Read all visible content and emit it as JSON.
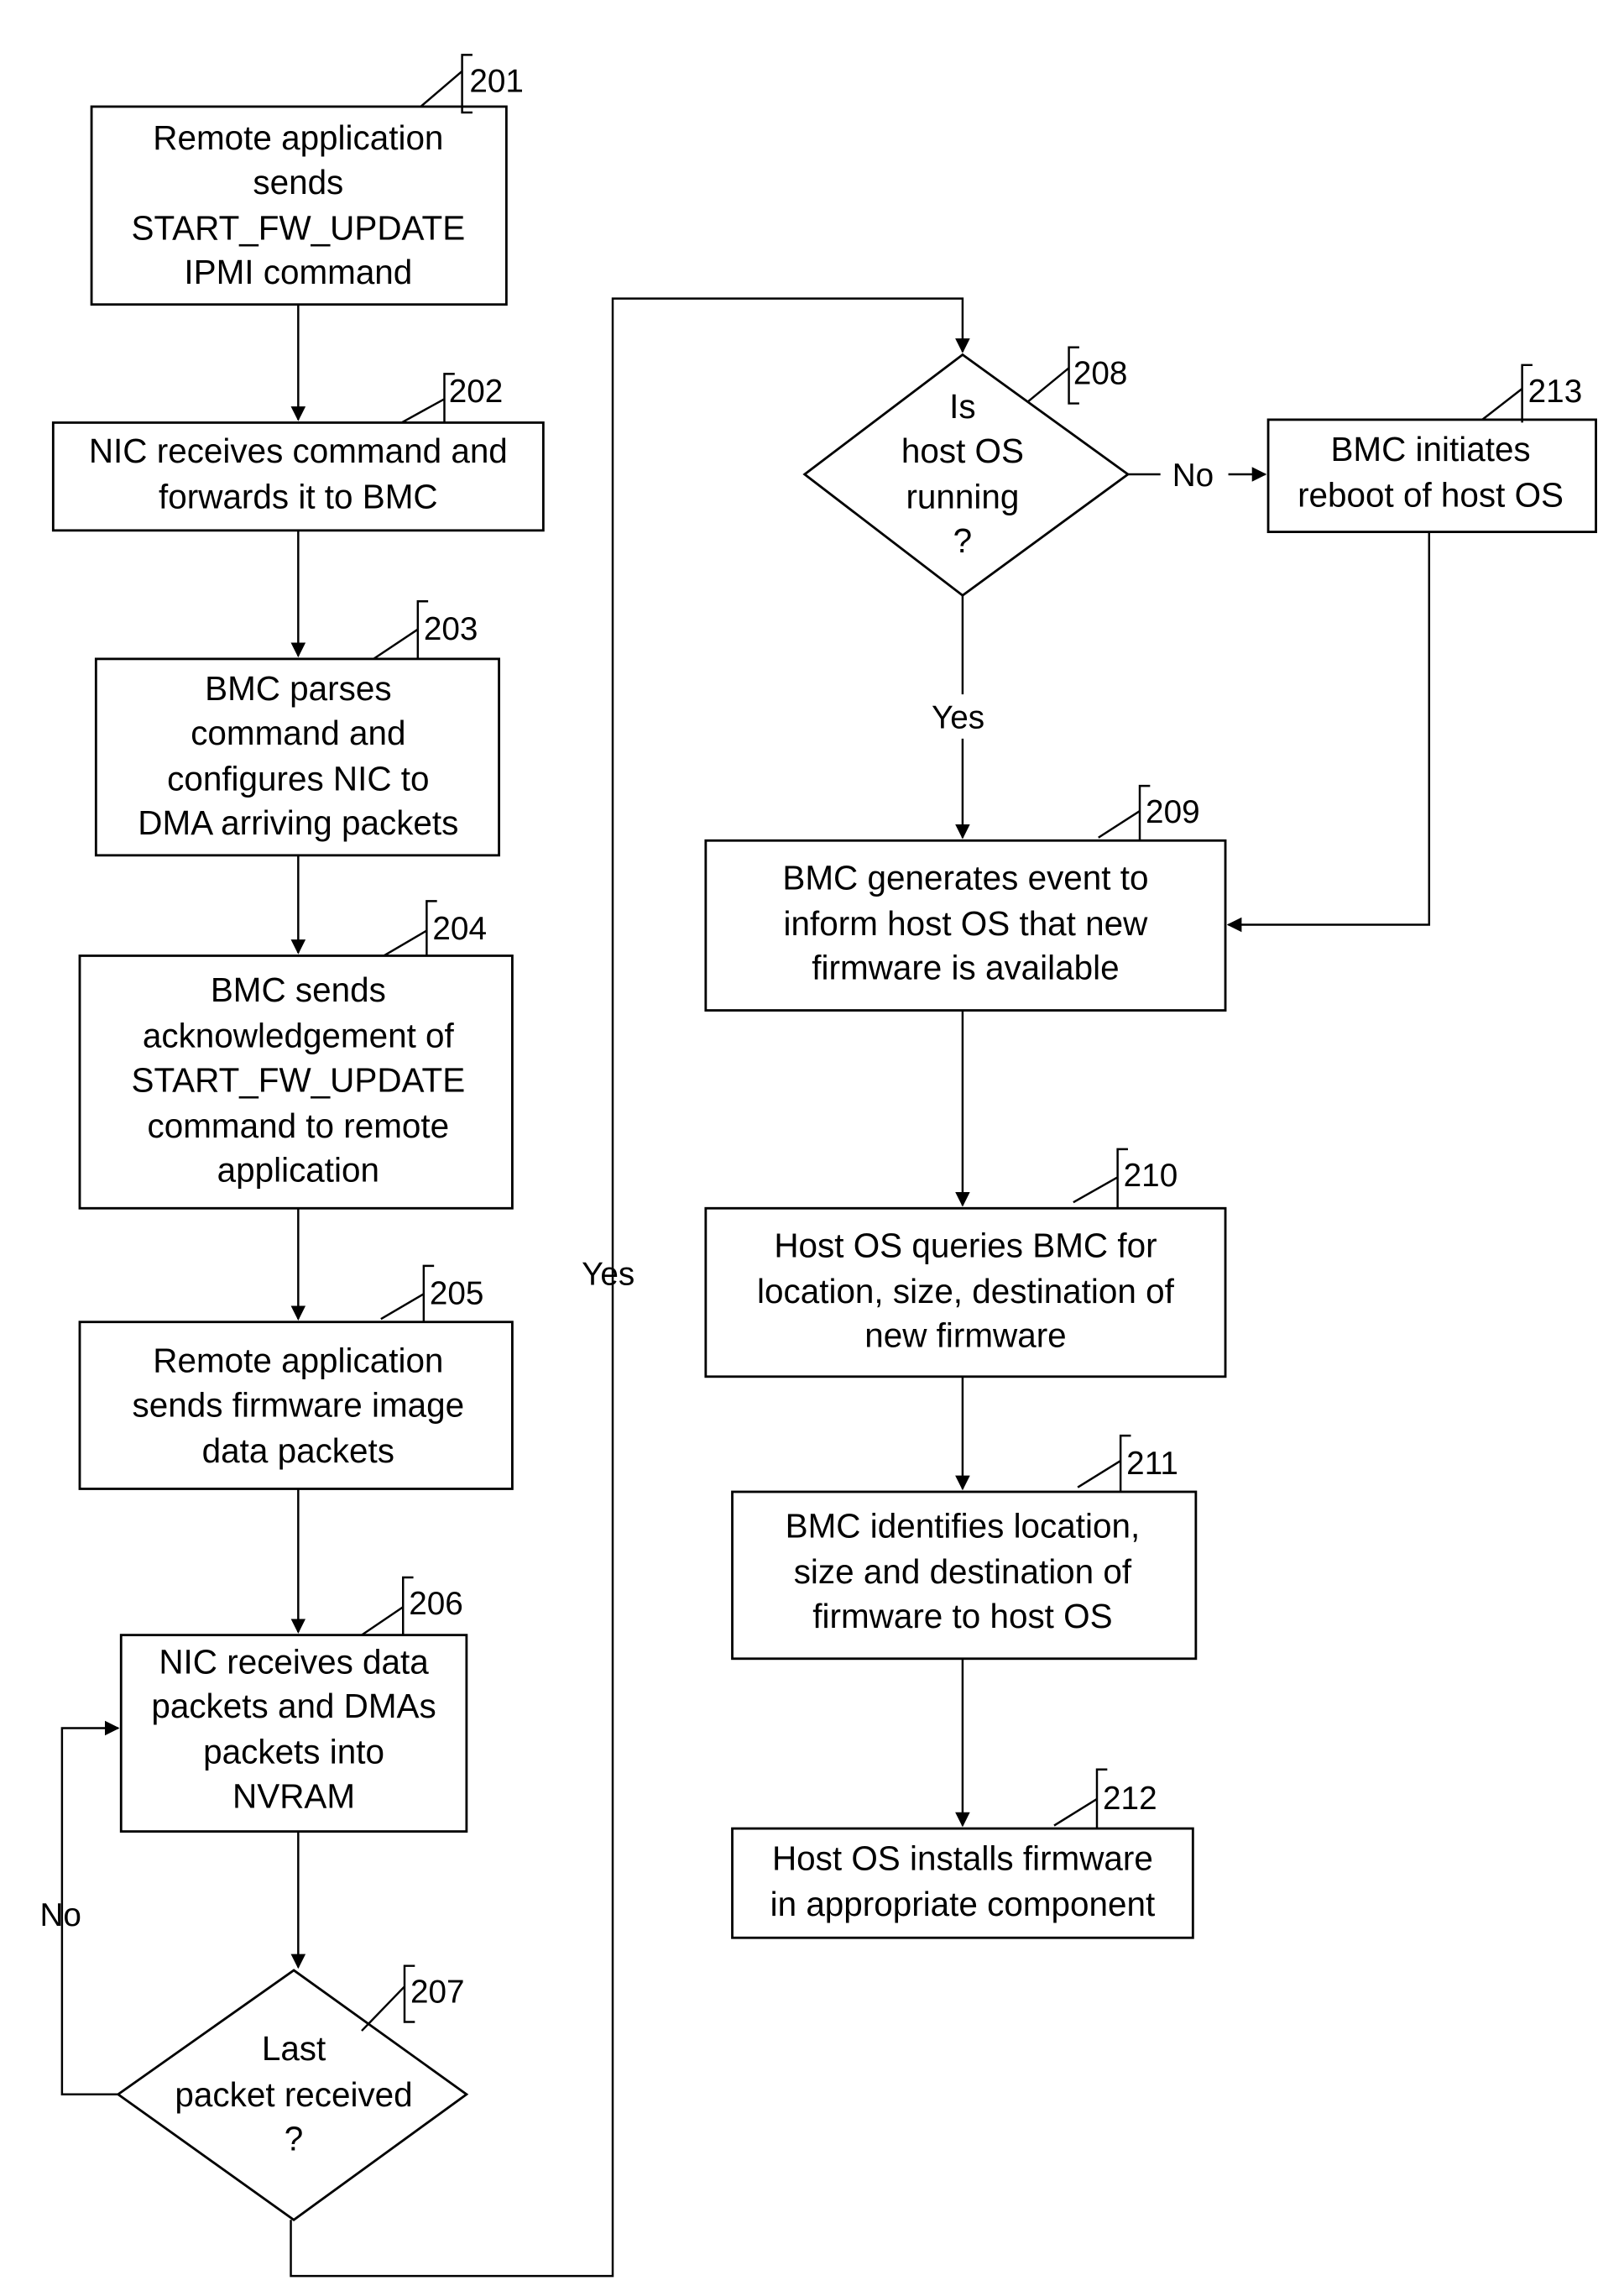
{
  "diagram": {
    "type": "flowchart",
    "nodes": [
      {
        "id": "201",
        "shape": "process",
        "lines": [
          "Remote application",
          "sends",
          "START_FW_UPDATE",
          "IPMI command"
        ]
      },
      {
        "id": "202",
        "shape": "process",
        "lines": [
          "NIC receives command and",
          "forwards it to BMC"
        ]
      },
      {
        "id": "203",
        "shape": "process",
        "lines": [
          "BMC parses",
          "command and",
          "configures NIC to",
          "DMA arriving packets"
        ]
      },
      {
        "id": "204",
        "shape": "process",
        "lines": [
          "BMC sends",
          "acknowledgement of",
          "START_FW_UPDATE",
          "command to remote",
          "application"
        ]
      },
      {
        "id": "205",
        "shape": "process",
        "lines": [
          "Remote application",
          "sends firmware image",
          "data packets"
        ]
      },
      {
        "id": "206",
        "shape": "process",
        "lines": [
          "NIC receives data",
          "packets and DMAs",
          "packets into",
          "NVRAM"
        ]
      },
      {
        "id": "207",
        "shape": "decision",
        "lines": [
          "Last",
          "packet received",
          "?"
        ]
      },
      {
        "id": "208",
        "shape": "decision",
        "lines": [
          "Is",
          "host OS",
          "running",
          "?"
        ]
      },
      {
        "id": "209",
        "shape": "process",
        "lines": [
          "BMC generates event to",
          "inform host OS that new",
          "firmware is available"
        ]
      },
      {
        "id": "210",
        "shape": "process",
        "lines": [
          "Host OS queries BMC for",
          "location, size, destination of",
          "new firmware"
        ]
      },
      {
        "id": "211",
        "shape": "process",
        "lines": [
          "BMC identifies location,",
          "size and destination of",
          "firmware to host OS"
        ]
      },
      {
        "id": "212",
        "shape": "process",
        "lines": [
          "Host OS installs firmware",
          "in appropriate component"
        ]
      },
      {
        "id": "213",
        "shape": "process",
        "lines": [
          "BMC initiates",
          "reboot of host OS"
        ]
      }
    ],
    "edges": [
      {
        "from": "201",
        "to": "202",
        "label": ""
      },
      {
        "from": "202",
        "to": "203",
        "label": ""
      },
      {
        "from": "203",
        "to": "204",
        "label": ""
      },
      {
        "from": "204",
        "to": "205",
        "label": ""
      },
      {
        "from": "205",
        "to": "206",
        "label": ""
      },
      {
        "from": "206",
        "to": "207",
        "label": ""
      },
      {
        "from": "207",
        "to": "206",
        "label": "No"
      },
      {
        "from": "207",
        "to": "208",
        "label": "Yes"
      },
      {
        "from": "208",
        "to": "213",
        "label": "No"
      },
      {
        "from": "208",
        "to": "209",
        "label": "Yes"
      },
      {
        "from": "213",
        "to": "209",
        "label": ""
      },
      {
        "from": "209",
        "to": "210",
        "label": ""
      },
      {
        "from": "210",
        "to": "211",
        "label": ""
      },
      {
        "from": "211",
        "to": "212",
        "label": ""
      }
    ]
  }
}
